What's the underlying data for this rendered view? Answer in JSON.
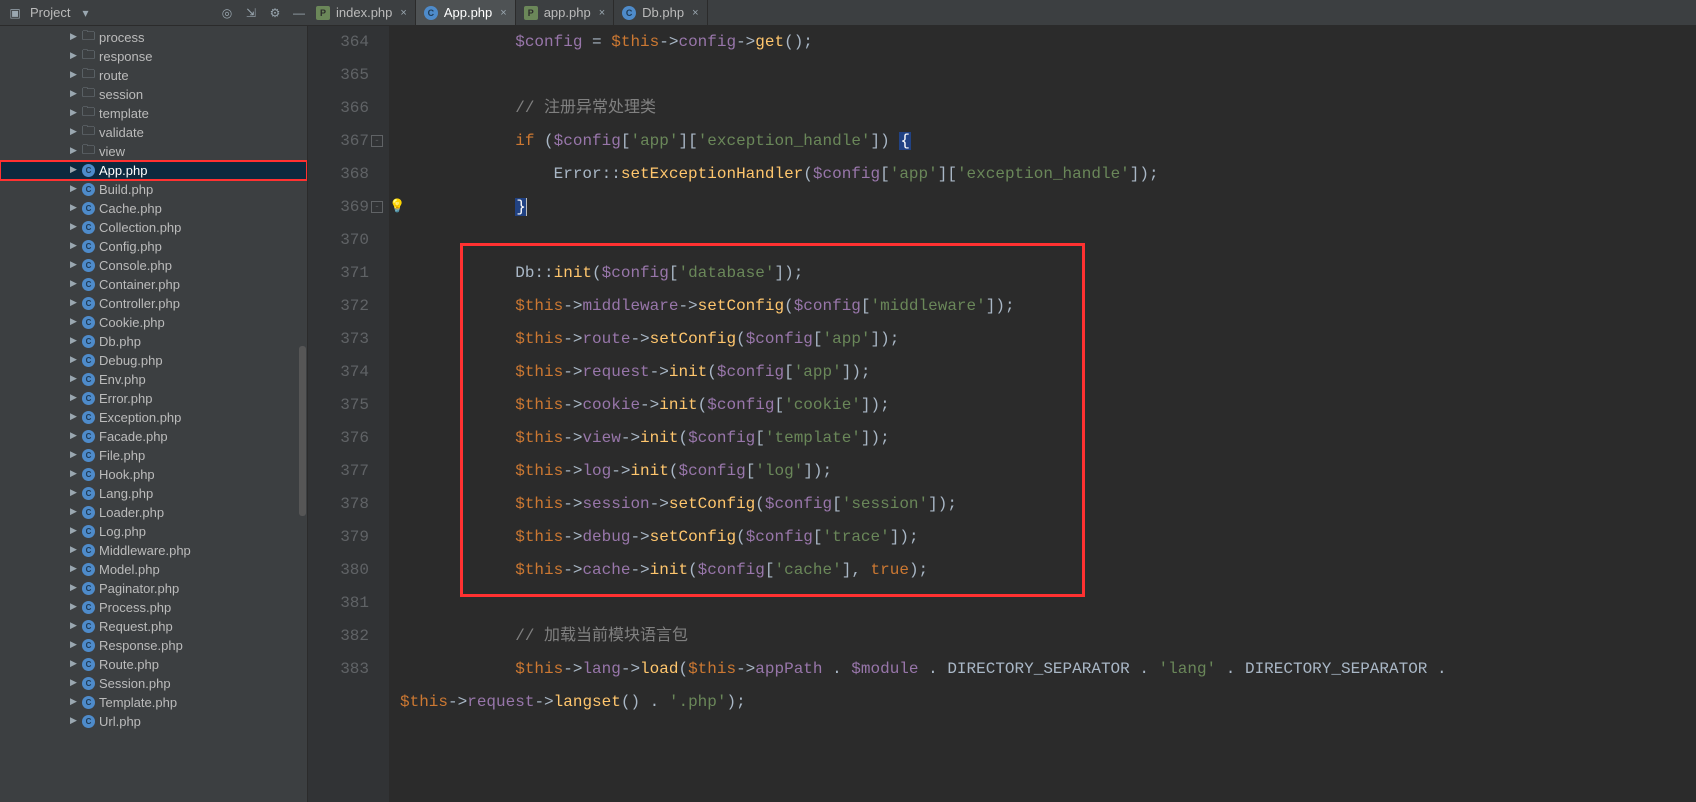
{
  "project_panel": {
    "title": "Project"
  },
  "tabs": [
    {
      "label": "index.php",
      "kind": "php",
      "active": false
    },
    {
      "label": "App.php",
      "kind": "cls",
      "active": true
    },
    {
      "label": "app.php",
      "kind": "php",
      "active": false
    },
    {
      "label": "Db.php",
      "kind": "cls",
      "active": false
    }
  ],
  "tree": [
    {
      "label": "process",
      "kind": "folder"
    },
    {
      "label": "response",
      "kind": "folder"
    },
    {
      "label": "route",
      "kind": "folder"
    },
    {
      "label": "session",
      "kind": "folder"
    },
    {
      "label": "template",
      "kind": "folder"
    },
    {
      "label": "validate",
      "kind": "folder"
    },
    {
      "label": "view",
      "kind": "folder"
    },
    {
      "label": "App.php",
      "kind": "cls",
      "selected": true,
      "highlighted": true
    },
    {
      "label": "Build.php",
      "kind": "cls"
    },
    {
      "label": "Cache.php",
      "kind": "cls"
    },
    {
      "label": "Collection.php",
      "kind": "cls"
    },
    {
      "label": "Config.php",
      "kind": "cls"
    },
    {
      "label": "Console.php",
      "kind": "cls"
    },
    {
      "label": "Container.php",
      "kind": "cls"
    },
    {
      "label": "Controller.php",
      "kind": "cls"
    },
    {
      "label": "Cookie.php",
      "kind": "cls"
    },
    {
      "label": "Db.php",
      "kind": "cls"
    },
    {
      "label": "Debug.php",
      "kind": "cls"
    },
    {
      "label": "Env.php",
      "kind": "cls"
    },
    {
      "label": "Error.php",
      "kind": "cls"
    },
    {
      "label": "Exception.php",
      "kind": "cls"
    },
    {
      "label": "Facade.php",
      "kind": "cls"
    },
    {
      "label": "File.php",
      "kind": "cls"
    },
    {
      "label": "Hook.php",
      "kind": "cls"
    },
    {
      "label": "Lang.php",
      "kind": "cls"
    },
    {
      "label": "Loader.php",
      "kind": "cls"
    },
    {
      "label": "Log.php",
      "kind": "cls"
    },
    {
      "label": "Middleware.php",
      "kind": "cls"
    },
    {
      "label": "Model.php",
      "kind": "cls"
    },
    {
      "label": "Paginator.php",
      "kind": "cls"
    },
    {
      "label": "Process.php",
      "kind": "cls"
    },
    {
      "label": "Request.php",
      "kind": "cls"
    },
    {
      "label": "Response.php",
      "kind": "cls"
    },
    {
      "label": "Route.php",
      "kind": "cls"
    },
    {
      "label": "Session.php",
      "kind": "cls"
    },
    {
      "label": "Template.php",
      "kind": "cls"
    },
    {
      "label": "Url.php",
      "kind": "cls"
    }
  ],
  "editor": {
    "first_line": 364,
    "current_line": 369,
    "highlight": {
      "from_line": 371,
      "to_line": 380
    },
    "lines": [
      {
        "n": 364,
        "tokens": [
          [
            "            ",
            ""
          ],
          [
            "$config",
            "v"
          ],
          [
            " = ",
            ""
          ],
          [
            "$this",
            "k"
          ],
          [
            "->",
            "op"
          ],
          [
            "config",
            "v"
          ],
          [
            "->",
            "op"
          ],
          [
            "get",
            "fn"
          ],
          [
            "();",
            ""
          ]
        ]
      },
      {
        "n": 365,
        "tokens": [
          [
            "",
            ""
          ]
        ]
      },
      {
        "n": 366,
        "tokens": [
          [
            "            ",
            ""
          ],
          [
            "// 注册异常处理类",
            "c"
          ]
        ]
      },
      {
        "n": 367,
        "tokens": [
          [
            "            ",
            ""
          ],
          [
            "if ",
            "k"
          ],
          [
            "(",
            ""
          ],
          [
            "$config",
            "v"
          ],
          [
            "[",
            ""
          ],
          [
            "'app'",
            "s"
          ],
          [
            "][",
            ""
          ],
          [
            "'exception_handle'",
            "s"
          ],
          [
            "]) ",
            ""
          ],
          [
            "{",
            "br-sel"
          ]
        ]
      },
      {
        "n": 368,
        "tokens": [
          [
            "                ",
            ""
          ],
          [
            "Error",
            "br"
          ],
          [
            "::",
            "op"
          ],
          [
            "setExceptionHandler",
            "fn"
          ],
          [
            "(",
            ""
          ],
          [
            "$config",
            "v"
          ],
          [
            "[",
            ""
          ],
          [
            "'app'",
            "s"
          ],
          [
            "][",
            ""
          ],
          [
            "'exception_handle'",
            "s"
          ],
          [
            "]);",
            ""
          ]
        ]
      },
      {
        "n": 369,
        "cur": true,
        "tokens": [
          [
            "            ",
            ""
          ],
          [
            "}",
            "br-sel"
          ],
          [
            "",
            "caret"
          ]
        ]
      },
      {
        "n": 370,
        "tokens": [
          [
            "",
            ""
          ]
        ]
      },
      {
        "n": 371,
        "tokens": [
          [
            "            ",
            ""
          ],
          [
            "Db",
            "br"
          ],
          [
            "::",
            "op"
          ],
          [
            "init",
            "fn"
          ],
          [
            "(",
            ""
          ],
          [
            "$config",
            "v"
          ],
          [
            "[",
            ""
          ],
          [
            "'database'",
            "s"
          ],
          [
            "]);",
            ""
          ]
        ]
      },
      {
        "n": 372,
        "tokens": [
          [
            "            ",
            ""
          ],
          [
            "$this",
            "k"
          ],
          [
            "->",
            "op"
          ],
          [
            "middleware",
            "v"
          ],
          [
            "->",
            "op"
          ],
          [
            "setConfig",
            "fn"
          ],
          [
            "(",
            ""
          ],
          [
            "$config",
            "v"
          ],
          [
            "[",
            ""
          ],
          [
            "'middleware'",
            "s"
          ],
          [
            "]);",
            ""
          ]
        ]
      },
      {
        "n": 373,
        "tokens": [
          [
            "            ",
            ""
          ],
          [
            "$this",
            "k"
          ],
          [
            "->",
            "op"
          ],
          [
            "route",
            "v"
          ],
          [
            "->",
            "op"
          ],
          [
            "setConfig",
            "fn"
          ],
          [
            "(",
            ""
          ],
          [
            "$config",
            "v"
          ],
          [
            "[",
            ""
          ],
          [
            "'app'",
            "s"
          ],
          [
            "]);",
            ""
          ]
        ]
      },
      {
        "n": 374,
        "tokens": [
          [
            "            ",
            ""
          ],
          [
            "$this",
            "k"
          ],
          [
            "->",
            "op"
          ],
          [
            "request",
            "v"
          ],
          [
            "->",
            "op"
          ],
          [
            "init",
            "fn"
          ],
          [
            "(",
            ""
          ],
          [
            "$config",
            "v"
          ],
          [
            "[",
            ""
          ],
          [
            "'app'",
            "s"
          ],
          [
            "]);",
            ""
          ]
        ]
      },
      {
        "n": 375,
        "tokens": [
          [
            "            ",
            ""
          ],
          [
            "$this",
            "k"
          ],
          [
            "->",
            "op"
          ],
          [
            "cookie",
            "v"
          ],
          [
            "->",
            "op"
          ],
          [
            "init",
            "fn"
          ],
          [
            "(",
            ""
          ],
          [
            "$config",
            "v"
          ],
          [
            "[",
            ""
          ],
          [
            "'cookie'",
            "s"
          ],
          [
            "]);",
            ""
          ]
        ]
      },
      {
        "n": 376,
        "tokens": [
          [
            "            ",
            ""
          ],
          [
            "$this",
            "k"
          ],
          [
            "->",
            "op"
          ],
          [
            "view",
            "v"
          ],
          [
            "->",
            "op"
          ],
          [
            "init",
            "fn"
          ],
          [
            "(",
            ""
          ],
          [
            "$config",
            "v"
          ],
          [
            "[",
            ""
          ],
          [
            "'template'",
            "s"
          ],
          [
            "]);",
            ""
          ]
        ]
      },
      {
        "n": 377,
        "tokens": [
          [
            "            ",
            ""
          ],
          [
            "$this",
            "k"
          ],
          [
            "->",
            "op"
          ],
          [
            "log",
            "v"
          ],
          [
            "->",
            "op"
          ],
          [
            "init",
            "fn"
          ],
          [
            "(",
            ""
          ],
          [
            "$config",
            "v"
          ],
          [
            "[",
            ""
          ],
          [
            "'log'",
            "s"
          ],
          [
            "]);",
            ""
          ]
        ]
      },
      {
        "n": 378,
        "tokens": [
          [
            "            ",
            ""
          ],
          [
            "$this",
            "k"
          ],
          [
            "->",
            "op"
          ],
          [
            "session",
            "v"
          ],
          [
            "->",
            "op"
          ],
          [
            "setConfig",
            "fn"
          ],
          [
            "(",
            ""
          ],
          [
            "$config",
            "v"
          ],
          [
            "[",
            ""
          ],
          [
            "'session'",
            "s"
          ],
          [
            "]);",
            ""
          ]
        ]
      },
      {
        "n": 379,
        "tokens": [
          [
            "            ",
            ""
          ],
          [
            "$this",
            "k"
          ],
          [
            "->",
            "op"
          ],
          [
            "debug",
            "v"
          ],
          [
            "->",
            "op"
          ],
          [
            "setConfig",
            "fn"
          ],
          [
            "(",
            ""
          ],
          [
            "$config",
            "v"
          ],
          [
            "[",
            ""
          ],
          [
            "'trace'",
            "s"
          ],
          [
            "]);",
            ""
          ]
        ]
      },
      {
        "n": 380,
        "tokens": [
          [
            "            ",
            ""
          ],
          [
            "$this",
            "k"
          ],
          [
            "->",
            "op"
          ],
          [
            "cache",
            "v"
          ],
          [
            "->",
            "op"
          ],
          [
            "init",
            "fn"
          ],
          [
            "(",
            ""
          ],
          [
            "$config",
            "v"
          ],
          [
            "[",
            ""
          ],
          [
            "'cache'",
            "s"
          ],
          [
            "], ",
            ""
          ],
          [
            "true",
            "k"
          ],
          [
            ");",
            ""
          ]
        ]
      },
      {
        "n": 381,
        "tokens": [
          [
            "",
            ""
          ]
        ]
      },
      {
        "n": 382,
        "tokens": [
          [
            "            ",
            ""
          ],
          [
            "// 加载当前模块语言包",
            "c"
          ]
        ]
      },
      {
        "n": 383,
        "tokens": [
          [
            "            ",
            ""
          ],
          [
            "$this",
            "k"
          ],
          [
            "->",
            "op"
          ],
          [
            "lang",
            "v"
          ],
          [
            "->",
            "op"
          ],
          [
            "load",
            "fn"
          ],
          [
            "(",
            ""
          ],
          [
            "$this",
            "k"
          ],
          [
            "->",
            "op"
          ],
          [
            "appPath ",
            "v"
          ],
          [
            ". ",
            ""
          ],
          [
            "$module ",
            "v"
          ],
          [
            ". ",
            ""
          ],
          [
            "DIRECTORY_SEPARATOR ",
            "br"
          ],
          [
            ". ",
            ""
          ],
          [
            "'lang' ",
            "s"
          ],
          [
            ". ",
            ""
          ],
          [
            "DIRECTORY_SEPARATOR ",
            "br"
          ],
          [
            ". ",
            ""
          ]
        ]
      },
      {
        "n": 383.1,
        "nolabel": true,
        "tokens": [
          [
            "",
            ""
          ],
          [
            "$this",
            "k"
          ],
          [
            "->",
            "op"
          ],
          [
            "request",
            "v"
          ],
          [
            "->",
            "op"
          ],
          [
            "langset",
            "fn"
          ],
          [
            "() . ",
            ""
          ],
          [
            "'.php'",
            "s"
          ],
          [
            ");",
            ""
          ]
        ]
      }
    ]
  }
}
